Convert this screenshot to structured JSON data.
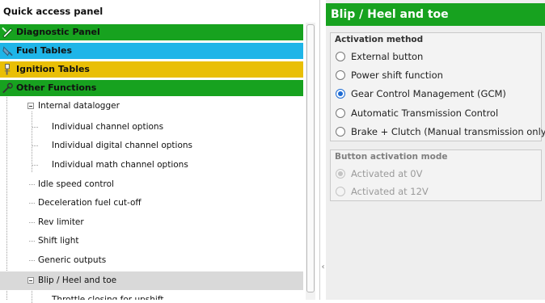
{
  "left_panel": {
    "title": "Quick access panel",
    "categories": [
      {
        "label": "Diagnostic Panel",
        "icon": "diagnostic-icon",
        "color": "#17a21f"
      },
      {
        "label": "Fuel Tables",
        "icon": "fuel-icon",
        "color": "#1fb5e8"
      },
      {
        "label": "Ignition Tables",
        "icon": "ignition-icon",
        "color": "#e9bf06"
      },
      {
        "label": "Other Functions",
        "icon": "tools-icon",
        "color": "#17a21f"
      }
    ],
    "tree": [
      {
        "label": "Internal datalogger"
      },
      {
        "label": "Individual channel options"
      },
      {
        "label": "Individual digital channel options"
      },
      {
        "label": "Individual math channel options"
      },
      {
        "label": "Idle speed control"
      },
      {
        "label": "Deceleration fuel cut-off"
      },
      {
        "label": "Rev limiter"
      },
      {
        "label": "Shift light"
      },
      {
        "label": "Generic outputs"
      },
      {
        "label": "Blip / Heel and toe"
      },
      {
        "label": "Throttle closing for upshift"
      }
    ]
  },
  "right_panel": {
    "header": "Blip / Heel and toe",
    "header_color": "#17a21f",
    "activation_method": {
      "title": "Activation method",
      "options": [
        {
          "label": "External button",
          "checked": false
        },
        {
          "label": "Power shift function",
          "checked": false
        },
        {
          "label": "Gear Control Management (GCM)",
          "checked": true
        },
        {
          "label": "Automatic Transmission Control",
          "checked": false
        },
        {
          "label": "Brake + Clutch (Manual transmission only)",
          "checked": false
        }
      ]
    },
    "button_activation_mode": {
      "title": "Button activation mode",
      "options": [
        {
          "label": "Activated at 0V",
          "checked": true,
          "disabled": true
        },
        {
          "label": "Activated at 12V",
          "checked": false,
          "disabled": true
        }
      ]
    }
  }
}
